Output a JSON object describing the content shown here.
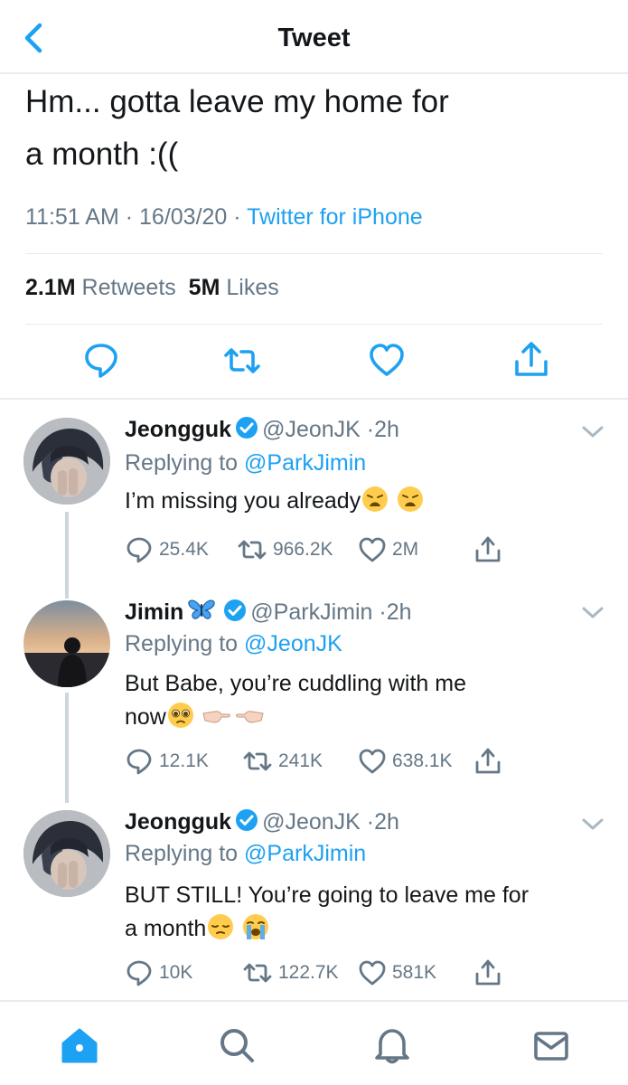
{
  "header": {
    "title": "Tweet"
  },
  "tweet": {
    "text_line1": "Hm... gotta leave my home for",
    "text_line2": "a month :((",
    "time": "11:51 AM",
    "date": "16/03/20",
    "source": "Twitter for iPhone",
    "retweets_count": "2.1M",
    "retweets_label": "Retweets",
    "likes_count": "5M",
    "likes_label": "Likes",
    "separator": "·"
  },
  "replies": [
    {
      "name": "Jeongguk",
      "handle": "@JeonJK",
      "age": "2h",
      "replying_prefix": "Replying to",
      "replying_to": "@ParkJimin",
      "text": "I’m missing you already",
      "emojis": [
        "weary-face",
        "weary-face"
      ],
      "reply_count": "25.4K",
      "retweet_count": "966.2K",
      "like_count": "2M"
    },
    {
      "name": "Jimin",
      "name_emoji": "blue-butterfly",
      "handle": "@ParkJimin",
      "age": "2h",
      "replying_prefix": "Replying to",
      "replying_to": "@JeonJK",
      "text_line1": "But Babe, you’re cuddling with me",
      "text_line2": "now",
      "emojis": [
        "pleading-face",
        "pointing-fingers"
      ],
      "reply_count": "12.1K",
      "retweet_count": "241K",
      "like_count": "638.1K"
    },
    {
      "name": "Jeongguk",
      "handle": "@JeonJK",
      "age": "2h",
      "replying_prefix": "Replying to",
      "replying_to": "@ParkJimin",
      "text_line1": "BUT STILL! You’re going to leave me for",
      "text_line2": "a month",
      "emojis": [
        "pensive-face",
        "loudly-crying-face"
      ],
      "reply_count": "10K",
      "retweet_count": "122.7K",
      "like_count": "581K"
    }
  ],
  "colors": {
    "accent": "#1da1f2",
    "text": "#14171a",
    "muted": "#657786",
    "divider": "#e6ecf0"
  },
  "tabbar": {
    "items": [
      "home-icon",
      "search-icon",
      "notifications-icon",
      "messages-icon"
    ],
    "active": "home-icon"
  }
}
